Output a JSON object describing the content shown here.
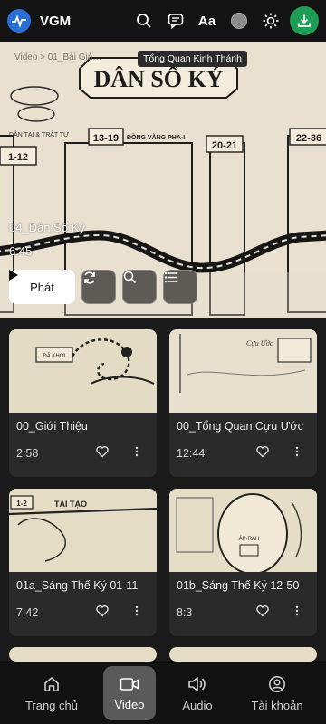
{
  "app": {
    "name": "VGM"
  },
  "header": {
    "font_label": "Aa"
  },
  "hero": {
    "breadcrumb": "Video  > 01_Bài Giả…",
    "tooltip": "Tổng Quan Kinh Thánh",
    "poster_heading": "DÂN SỐ KÝ",
    "poster_ranges": [
      "1-12",
      "13-19",
      "20-21",
      "22-36"
    ],
    "poster_section": "ĐỒNG VĂNG PHA-I",
    "title": "04_Dân Số Ký",
    "duration": "6:45",
    "play_label": "Phát"
  },
  "videos": [
    {
      "title": "00_Giới Thiệu",
      "duration": "2:58"
    },
    {
      "title": "00_Tổng Quan Cựu Ước",
      "duration": "12:44"
    },
    {
      "title": "01a_Sáng Thế Ký 01-11",
      "duration": "7:42"
    },
    {
      "title": "01b_Sáng Thế Ký 12-50",
      "duration": "8:3"
    }
  ],
  "nav": [
    {
      "label": "Trang chủ",
      "icon": "home-icon"
    },
    {
      "label": "Video",
      "icon": "video-icon",
      "active": true
    },
    {
      "label": "Audio",
      "icon": "speaker-icon"
    },
    {
      "label": "Tài khoản",
      "icon": "account-icon"
    }
  ],
  "colors": {
    "accent_green": "#1f9d55",
    "logo_blue": "#2a6fd6",
    "parchment": "#e9e0cf"
  }
}
